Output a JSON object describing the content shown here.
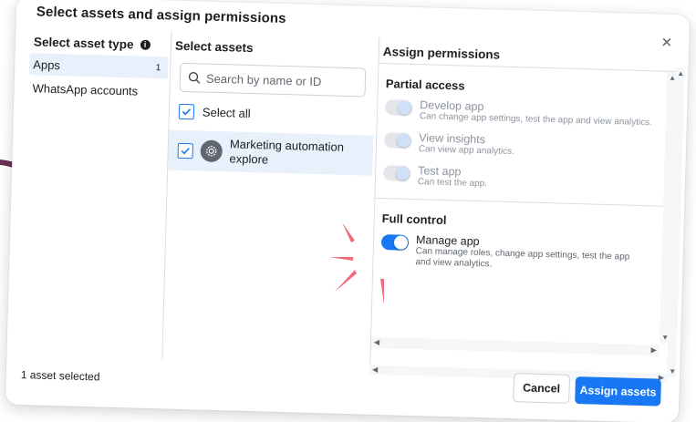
{
  "dialog": {
    "title": "Select assets and assign permissions",
    "close_icon": "close-icon"
  },
  "columns": {
    "asset_type_header": "Select asset type",
    "assets_header": "Select assets",
    "permissions_header": "Assign permissions"
  },
  "asset_types": [
    {
      "label": "Apps",
      "count": "1",
      "selected": true
    },
    {
      "label": "WhatsApp accounts",
      "count": "",
      "selected": false
    }
  ],
  "assets": {
    "search_placeholder": "Search by name or ID",
    "select_all_label": "Select all",
    "items": [
      {
        "name": "Marketing automation explore",
        "checked": true,
        "icon": "gear-icon"
      }
    ]
  },
  "permissions": {
    "partial_title": "Partial access",
    "partial": [
      {
        "name": "Develop app",
        "desc": "Can change app settings, test the app and view analytics."
      },
      {
        "name": "View insights",
        "desc": "Can view app analytics."
      },
      {
        "name": "Test app",
        "desc": "Can test the app."
      }
    ],
    "full_title": "Full control",
    "full": [
      {
        "name": "Manage app",
        "desc": "Can manage roles, change app settings, test the app and view analytics.",
        "on": true
      }
    ]
  },
  "footer": {
    "status": "1 asset selected",
    "cancel_label": "Cancel",
    "assign_label": "Assign assets"
  },
  "colors": {
    "accent": "#1877f2",
    "selected_bg": "#e7f0fb",
    "annotation_arrow": "#6b2f57",
    "annotation_burst": "#f06b78"
  }
}
